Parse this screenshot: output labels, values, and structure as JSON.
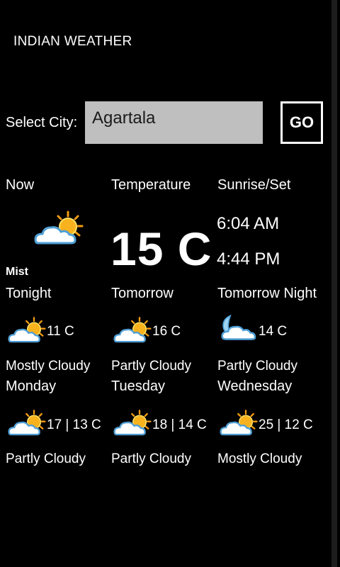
{
  "app": {
    "title": "INDIAN WEATHER"
  },
  "search": {
    "label": "Select City:",
    "value": "Agartala",
    "go_label": "GO"
  },
  "current": {
    "now_header": "Now",
    "temperature_header": "Temperature",
    "sunrise_header": "Sunrise/Set",
    "temperature": "15 C",
    "sunrise": "6:04 AM",
    "sunset": "4:44 PM",
    "condition": "Mist",
    "icon": "partly-cloudy-icon"
  },
  "forecast_row1": [
    {
      "name": "Tonight",
      "temp": "11  C",
      "condition": "Mostly Cloudy",
      "icon": "partly-cloudy-icon"
    },
    {
      "name": "Tomorrow",
      "temp": "16 C",
      "condition": "Partly Cloudy",
      "icon": "partly-cloudy-icon"
    },
    {
      "name": "Tomorrow Night",
      "temp": "14  C",
      "condition": "Partly Cloudy",
      "icon": "cloudy-night-icon"
    }
  ],
  "forecast_row2": [
    {
      "name": "Monday",
      "temp": "17 | 13  C",
      "condition": "Partly Cloudy",
      "icon": "partly-cloudy-icon"
    },
    {
      "name": "Tuesday",
      "temp": "18 | 14  C",
      "condition": "Partly Cloudy",
      "icon": "partly-cloudy-icon"
    },
    {
      "name": "Wednesday",
      "temp": "25 | 12  C",
      "condition": "Mostly Cloudy",
      "icon": "partly-cloudy-icon"
    }
  ],
  "colors": {
    "background": "#000000",
    "input_bg": "#bfbfbf",
    "sun": "#f7b21d",
    "cloud": "#ffffff",
    "cloud_edge": "#4f9fd6"
  }
}
